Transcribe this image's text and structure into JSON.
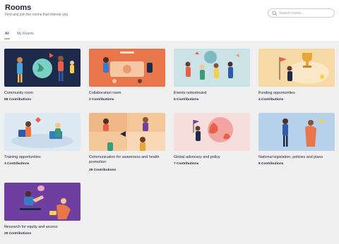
{
  "header": {
    "title": "Rooms",
    "subtitle": "Find and join the rooms that interest you."
  },
  "search": {
    "placeholder": "Search rooms..."
  },
  "tabs": [
    {
      "label": "All",
      "active": true
    },
    {
      "label": "My Rooms",
      "active": false
    }
  ],
  "colors": {
    "accent": "#c9a88f",
    "background": "#f0f0f1"
  },
  "rooms": [
    {
      "name": "Community room",
      "contributions": "58 Contributions",
      "bg": "#1e2a4a"
    },
    {
      "name": "Collaboration room",
      "contributions": "2 Contributions",
      "bg": "#e9764a"
    },
    {
      "name": "Events noticeboard",
      "contributions": "5 Contributions",
      "bg": "#cbe3e6"
    },
    {
      "name": "Funding opportunities",
      "contributions": "4 Contributions",
      "bg": "#f7d9a6"
    },
    {
      "name": "Training opportunities",
      "contributions": "3 Contributions",
      "bg": "#dde9f3"
    },
    {
      "name": "Communication for awareness and health promotion",
      "contributions": "29 Contributions",
      "bg": "#f5c89b"
    },
    {
      "name": "Global advocacy and policy",
      "contributions": "7 Contributions",
      "bg": "#f6dedc"
    },
    {
      "name": "National legislation, policies and plans",
      "contributions": "6 Contributions",
      "bg": "#b7d2ea"
    },
    {
      "name": "Research for equity and access",
      "contributions": "20 Contributions",
      "bg": "#6e3fa0"
    }
  ]
}
